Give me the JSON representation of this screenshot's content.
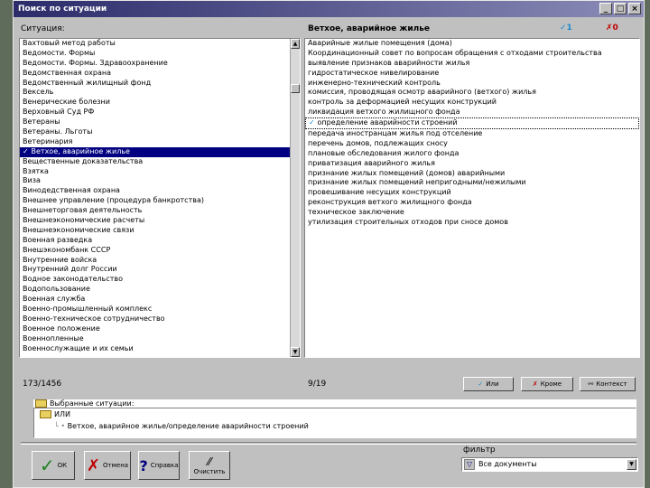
{
  "window": {
    "title": "Поиск по ситуации",
    "controls": [
      "_",
      "□",
      "×"
    ]
  },
  "left_panel": {
    "header": "Ситуация:",
    "items": [
      {
        "text": "Вахтовый метод работы",
        "checked": false,
        "selected": false
      },
      {
        "text": "Ведомости. Формы",
        "checked": false,
        "selected": false
      },
      {
        "text": "Ведомости. Формы. Здравоохранение",
        "checked": false,
        "selected": false
      },
      {
        "text": "Ведомственная охрана",
        "checked": false,
        "selected": false
      },
      {
        "text": "Ведомственный жилищный фонд",
        "checked": false,
        "selected": false
      },
      {
        "text": "Вексель",
        "checked": false,
        "selected": false
      },
      {
        "text": "Венерические болезни",
        "checked": false,
        "selected": false
      },
      {
        "text": "Верховный Суд РФ",
        "checked": false,
        "selected": false
      },
      {
        "text": "Ветераны",
        "checked": false,
        "selected": false
      },
      {
        "text": "Ветераны. Льготы",
        "checked": false,
        "selected": false
      },
      {
        "text": "Ветеринария",
        "checked": false,
        "selected": false
      },
      {
        "text": "Ветхое, аварийное жилье",
        "checked": true,
        "selected": true
      },
      {
        "text": "Вещественные доказательства",
        "checked": false,
        "selected": false
      },
      {
        "text": "Взятка",
        "checked": false,
        "selected": false
      },
      {
        "text": "Виза",
        "checked": false,
        "selected": false
      },
      {
        "text": "Винодедственная охрана",
        "checked": false,
        "selected": false
      },
      {
        "text": "Внешнее управление (процедура банкротства)",
        "checked": false,
        "selected": false
      },
      {
        "text": "Внешнеторговая деятельность",
        "checked": false,
        "selected": false
      },
      {
        "text": "Внешнеэкономические расчеты",
        "checked": false,
        "selected": false
      },
      {
        "text": "Внешнеэкономические связи",
        "checked": false,
        "selected": false
      },
      {
        "text": "Военная разведка",
        "checked": false,
        "selected": false
      },
      {
        "text": "Внешэкономбанк СССР",
        "checked": false,
        "selected": false
      },
      {
        "text": "Внутренние войска",
        "checked": false,
        "selected": false
      },
      {
        "text": "Внутренний долг России",
        "checked": false,
        "selected": false
      },
      {
        "text": "Водное законодательство",
        "checked": false,
        "selected": false
      },
      {
        "text": "Водопользование",
        "checked": false,
        "selected": false
      },
      {
        "text": "Военная служба",
        "checked": false,
        "selected": false
      },
      {
        "text": "Военно-промышленный комплекс",
        "checked": false,
        "selected": false
      },
      {
        "text": "Военно-техническое сотрудничество",
        "checked": false,
        "selected": false
      },
      {
        "text": "Военное положение",
        "checked": false,
        "selected": false
      },
      {
        "text": "Военнопленные",
        "checked": false,
        "selected": false
      },
      {
        "text": "Военнослужащие и их семьи",
        "checked": false,
        "selected": false
      }
    ],
    "counter": "173/1456"
  },
  "right_panel": {
    "header": "Ветхое, аварийное жилье",
    "check_count": "1",
    "cross_count": "0",
    "items": [
      {
        "text": "Аварийные жилые помещения (дома)",
        "checked": false
      },
      {
        "text": "Координационный совет по вопросам обращения с отходами строительства",
        "checked": false
      },
      {
        "text": "выявление признаков аварийности жилья",
        "checked": false
      },
      {
        "text": "гидростатическое нивелирование",
        "checked": false
      },
      {
        "text": "инженерно-технический контроль",
        "checked": false
      },
      {
        "text": "комиссия, проводящая осмотр аварийного (ветхого) жилья",
        "checked": false
      },
      {
        "text": "контроль за деформацией несущих конструкций",
        "checked": false
      },
      {
        "text": "ликвидация ветхого жилищного фонда",
        "checked": false
      },
      {
        "text": "определение аварийности строений",
        "checked": true
      },
      {
        "text": "передача иностранцам жилья под отселение",
        "checked": false
      },
      {
        "text": "перечень домов, подлежащих сносу",
        "checked": false
      },
      {
        "text": "плановые обследования жилого фонда",
        "checked": false
      },
      {
        "text": "приватизация аварийного жилья",
        "checked": false
      },
      {
        "text": "признание жилых помещений (домов) аварийными",
        "checked": false
      },
      {
        "text": "признание жилых помещений непригодными/нежилыми",
        "checked": false
      },
      {
        "text": "провешивание несущих конструкций",
        "checked": false
      },
      {
        "text": "реконструкция ветхого жилищного фонда",
        "checked": false
      },
      {
        "text": "техническое заключение",
        "checked": false
      },
      {
        "text": "утилизация строительных отходов при сносе домов",
        "checked": false
      }
    ],
    "counter": "9/19",
    "buttons": {
      "and_label": "Или",
      "exclude_label": "Кроме",
      "context_label": "Контекст"
    }
  },
  "selected": {
    "header": "Выбранные ситуации:",
    "node_label": "ИЛИ",
    "entry": "Ветхое, аварийное жилье/определение аварийности строений"
  },
  "bottom": {
    "ok_label": "ОК",
    "cancel_label": "Отмена",
    "help_label": "Справка",
    "clear_label": "Очистить",
    "filter_label": "фильтр",
    "filter_value": "Все документы"
  }
}
